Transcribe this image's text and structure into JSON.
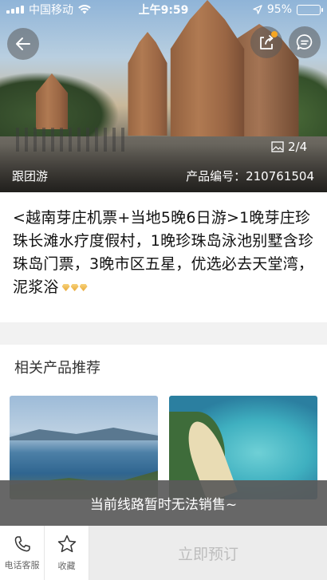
{
  "status_bar": {
    "carrier": "中国移动",
    "time": "上午9:59",
    "battery_percent": "95%",
    "battery_level": 0.95,
    "battery_color": "#4cd964"
  },
  "hero": {
    "image_counter": "2/4",
    "tour_type": "跟团游",
    "product_number": "产品编号：210761504"
  },
  "product": {
    "title": "<越南芽庄机票+当地5晚6日游>1晚芽庄珍珠长滩水疗度假村，1晚珍珠岛泳池别墅含珍珠岛门票，3晚市区五星，优选必去天堂湾，泥浆浴",
    "rating_icon": "diamond-icon",
    "rating_count": 3
  },
  "related": {
    "title": "相关产品推荐"
  },
  "notice": {
    "text": "当前线路暂时无法销售~"
  },
  "bottom_bar": {
    "service_label": "电话客服",
    "favorite_label": "收藏",
    "book_label": "立即预订"
  },
  "colors": {
    "accent": "#f5a623",
    "disabled_text": "#bdbdbd",
    "notice_bg": "#5a5a5a"
  }
}
